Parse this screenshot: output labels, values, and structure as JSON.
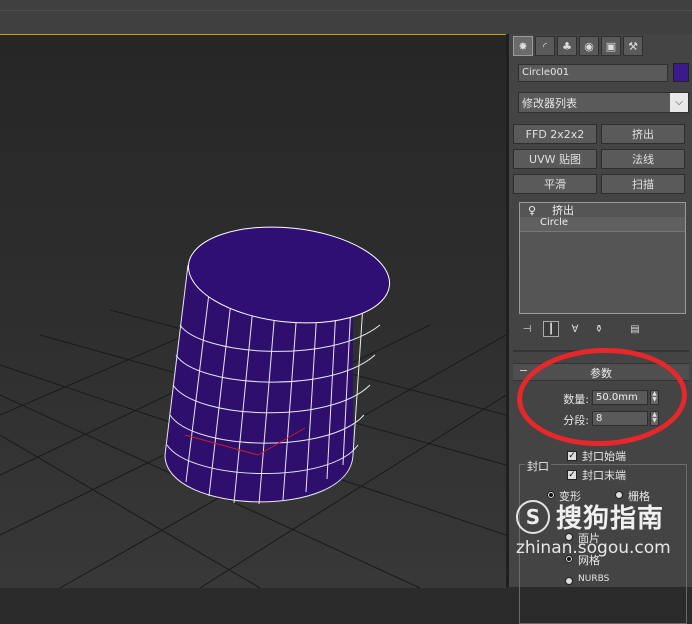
{
  "panel": {
    "tabs": [
      {
        "icon": "create-icon",
        "glyph": "✸"
      },
      {
        "icon": "modify-icon",
        "glyph": "◜"
      },
      {
        "icon": "hierarchy-icon",
        "glyph": "♣"
      },
      {
        "icon": "motion-icon",
        "glyph": "◉"
      },
      {
        "icon": "display-icon",
        "glyph": "▣"
      },
      {
        "icon": "utilities-icon",
        "glyph": "⚒"
      }
    ],
    "object_name": "Circle001",
    "object_color": "#3a1a8c",
    "modifier_list": "修改器列表",
    "modifier_buttons": [
      "FFD 2x2x2",
      "挤出",
      "UVW 贴图",
      "法线",
      "平滑",
      "扫描"
    ],
    "stack": {
      "top": "挤出",
      "base": "Circle"
    },
    "parameters": {
      "title": "参数",
      "amount_label": "数量:",
      "amount_value": "50.0mm",
      "segments_label": "分段:",
      "segments_value": "8",
      "cap_group": "封口",
      "cap_start": "封口始端",
      "cap_end": "封口末端",
      "morph": "变形",
      "grid": "栅格",
      "output_patch": "面片",
      "output_mesh": "网格",
      "output_nurbs": "NURBS"
    }
  },
  "colors": {
    "accent": "#c8a000",
    "annotation": "#e8272b",
    "cylinder": "#2e0f6e"
  },
  "watermark": {
    "brand": "搜狗指南",
    "url": "zhinan.sogou.com",
    "logo_letter": "S"
  }
}
